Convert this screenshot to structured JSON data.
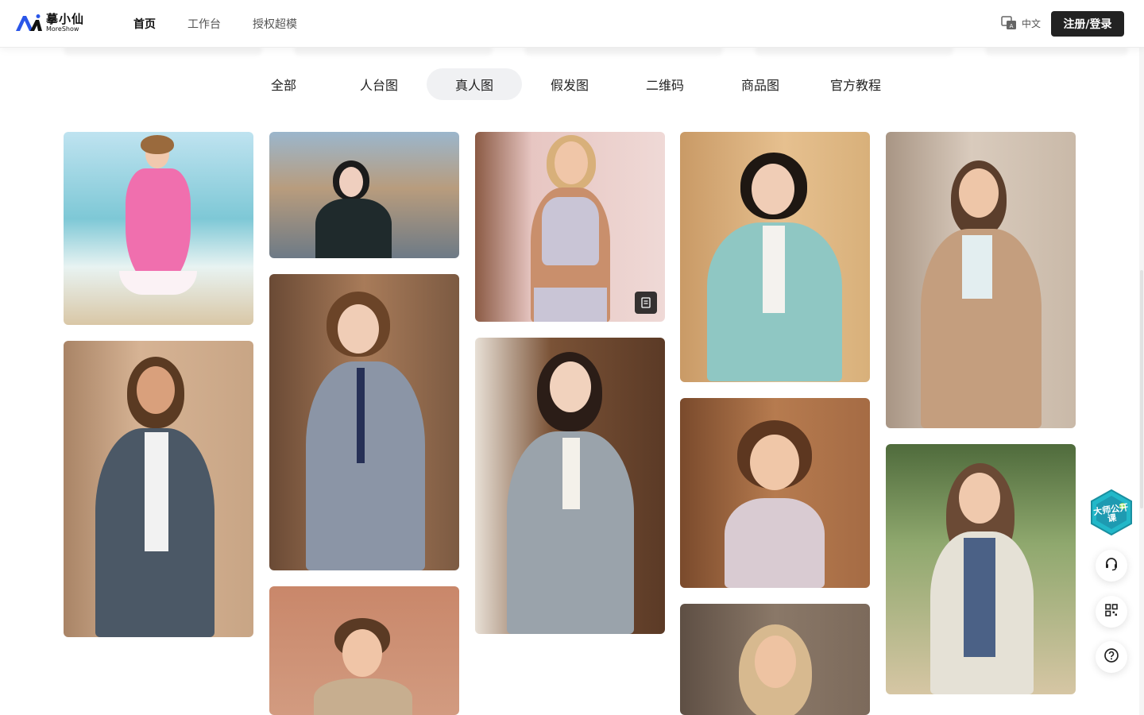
{
  "brand": {
    "name_cn": "摹小仙",
    "name_en": "MoreShow",
    "accent": "#3b6cf6"
  },
  "nav": {
    "items": [
      "首页",
      "工作台",
      "授权超模"
    ],
    "active_index": 0
  },
  "header": {
    "language_label": "中文",
    "login_label": "注册/登录"
  },
  "categories": {
    "items": [
      "全部",
      "人台图",
      "真人图",
      "假发图",
      "二维码",
      "商品图",
      "官方教程"
    ],
    "active_index": 2
  },
  "gallery": {
    "cards": [
      {
        "subject": "girl in pink gingham dress on beach",
        "colors": [
          "#7ec8d6",
          "#f06fae",
          "#d9c7a6"
        ]
      },
      {
        "subject": "woman in charcoal suit on street",
        "colors": [
          "#c8a585",
          "#4b5866",
          "#f2f2f2"
        ]
      },
      {
        "subject": "woman in black puffer jacket on street",
        "colors": [
          "#b89c7d",
          "#1f2a2c",
          "#6d7a86"
        ]
      },
      {
        "subject": "woman in grey suit with tie",
        "colors": [
          "#a87b59",
          "#8b95a6",
          "#6a4a35"
        ]
      },
      {
        "subject": "curly-haired boy in beige t-shirt",
        "colors": [
          "#c9876a",
          "#c7ae8f",
          "#5a3a24"
        ]
      },
      {
        "subject": "blonde woman in lilac sports bra",
        "colors": [
          "#e7c6c2",
          "#c9c5d6",
          "#c98f6c"
        ]
      },
      {
        "subject": "woman in grey blazer by door",
        "colors": [
          "#7a5236",
          "#9aa3ab",
          "#2b1d17"
        ]
      },
      {
        "subject": "woman in mint cardigan",
        "colors": [
          "#d8b07a",
          "#8fc7c3",
          "#1e1712"
        ]
      },
      {
        "subject": "girl with bob haircut in floral dress",
        "colors": [
          "#a56b44",
          "#d9cbd2",
          "#5d3720"
        ]
      },
      {
        "subject": "woman with wavy blonde hair",
        "colors": [
          "#7c6a5b",
          "#d7b98f",
          "#c28f6a"
        ]
      },
      {
        "subject": "woman in camel coat",
        "colors": [
          "#c9b9a8",
          "#c49e7e",
          "#5b3e2c"
        ]
      },
      {
        "subject": "woman in white cardigan in park",
        "colors": [
          "#8fa86e",
          "#e5e1d6",
          "#6b4a35"
        ]
      }
    ]
  },
  "floating": {
    "promo_text": "大师公开课",
    "tools": [
      "customer-service",
      "qr-code",
      "help"
    ]
  }
}
